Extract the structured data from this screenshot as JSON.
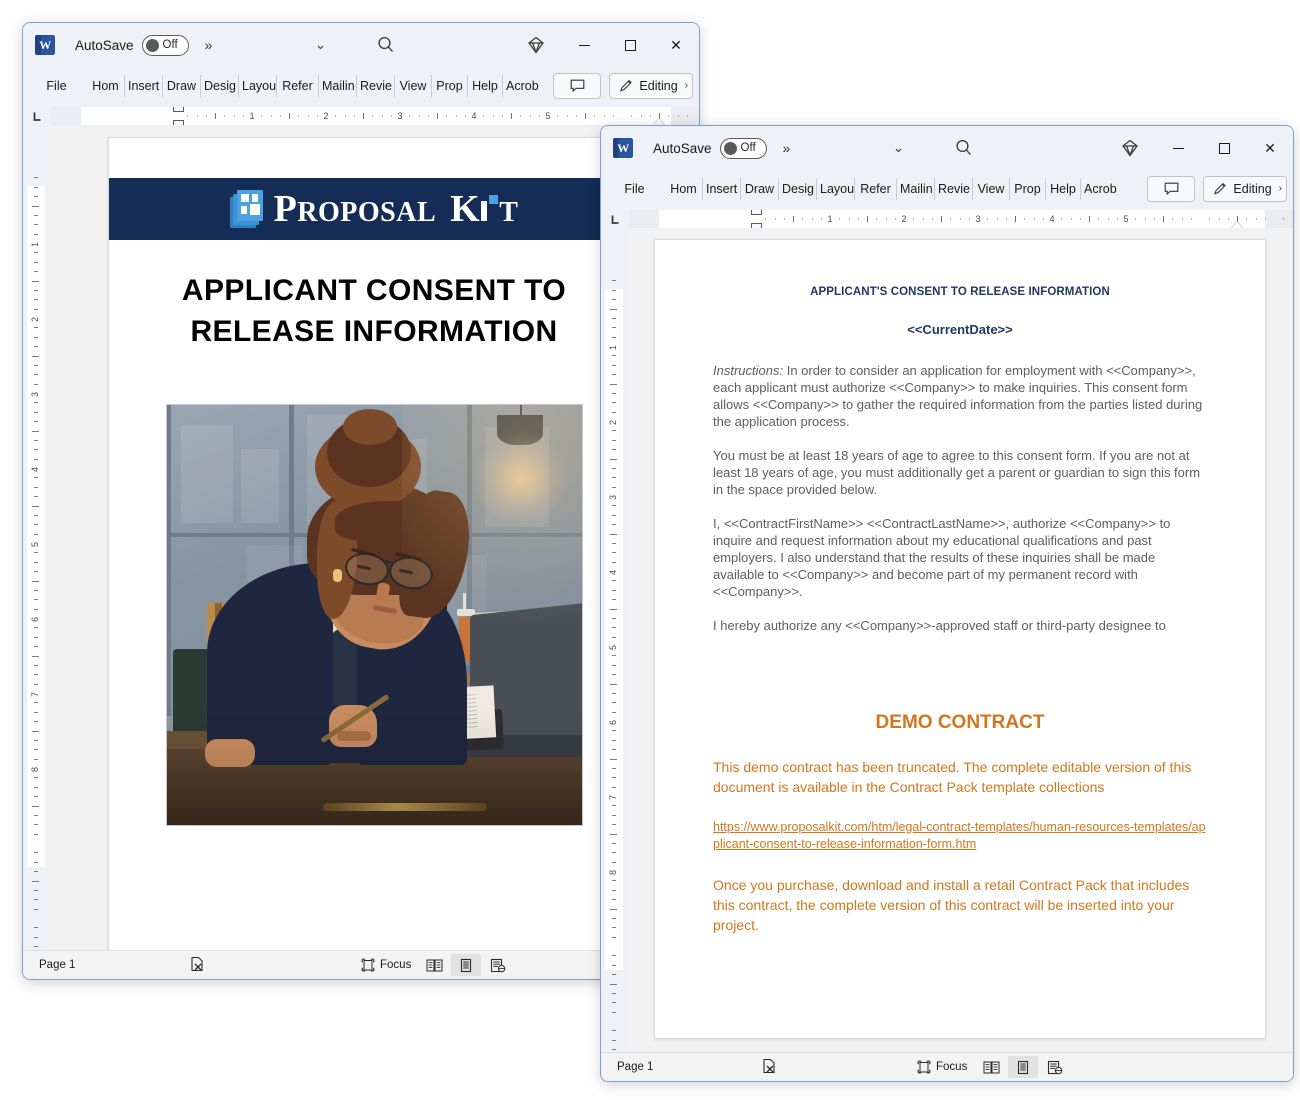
{
  "app": {
    "icon": "word-icon",
    "icon_letter": "W",
    "autosave_label": "AutoSave",
    "autosave_state": "Off",
    "overflow_chevron": "»",
    "qat_caret": "⌄",
    "search_icon": "search-icon",
    "diamond_icon": "diamond-icon",
    "minimize": "minimize-icon",
    "maximize": "maximize-icon",
    "close": "close-icon",
    "close_glyph": "✕"
  },
  "ribbon": {
    "tabs": [
      "File",
      "Hom",
      "Insert",
      "Draw",
      "Desig",
      "Layou",
      "Refer",
      "Mailin",
      "Revie",
      "View",
      "Prop",
      "Help",
      "Acrob"
    ],
    "comment_button": "comment-icon",
    "editing_label": "Editing",
    "editing_chevron": "›",
    "pencil_icon": "pencil-icon"
  },
  "ruler": {
    "tab_stop_marker": "L",
    "h_numbers": [
      "1",
      "2",
      "3",
      "4",
      "5"
    ],
    "v_numbers": [
      "1",
      "2",
      "3",
      "4",
      "5",
      "6",
      "7",
      "8"
    ]
  },
  "statusbar": {
    "page_label": "Page 1",
    "proofing_icon": "proofing-errors-icon",
    "focus_label": "Focus",
    "focus_icon": "focus-icon",
    "views": [
      {
        "name": "read-mode-view",
        "icon": "book-icon",
        "active": false
      },
      {
        "name": "print-layout-view",
        "icon": "page-icon",
        "active": true
      },
      {
        "name": "web-layout-view",
        "icon": "web-icon",
        "active": false
      }
    ]
  },
  "window_back": {
    "name": "word-window-proposal-kit-cover",
    "document": {
      "banner": {
        "brand_word_1": "P",
        "brand_word_1_rest": "ROPOSAL",
        "brand_word_2": "K",
        "brand_word_2_rest": "T",
        "background_color": "#152c56",
        "logo_icon": "proposal-kit-logo-icon"
      },
      "title_line_1": "APPLICANT CONSENT TO",
      "title_line_2": "RELEASE INFORMATION",
      "illustration_alt": "businesswoman-signing-document-illustration"
    }
  },
  "window_front": {
    "name": "word-window-consent-form",
    "document": {
      "heading": "APPLICANT'S CONSENT TO RELEASE INFORMATION",
      "date_field": "<<CurrentDate>>",
      "paragraphs": [
        {
          "lead": "Instructions:",
          "text": " In order to consider an application for employment with <<Company>>, each applicant must authorize <<Company>> to make inquiries. This consent form allows <<Company>> to gather the required information from the parties listed during the application process."
        },
        {
          "lead": "",
          "text": "You must be at least 18 years of age to agree to this consent form. If you are not at least 18 years of age, you must additionally get a parent or guardian to sign this form in the space provided below."
        },
        {
          "lead": "",
          "text": "I, <<ContractFirstName>> <<ContractLastName>>, authorize <<Company>> to inquire and request information about my educational qualifications and past employers.  I also understand that the results of these inquiries shall be made available to <<Company>> and become part of my permanent record with <<Company>>."
        },
        {
          "lead": "",
          "text": "I hereby authorize any <<Company>>-approved staff or third-party designee to"
        }
      ],
      "demo_heading": "DEMO CONTRACT",
      "demo_paragraph_1": "This demo contract has been truncated. The complete editable version of this document is available in the Contract Pack template collections",
      "demo_link": "https://www.proposalkit.com/htm/legal-contract-templates/human-resources-templates/applicant-consent-to-release-information-form.htm",
      "demo_paragraph_2": "Once you purchase, download and install a retail Contract Pack that includes this contract, the complete version of this contract will be inserted into your project.",
      "accent_color": "#d2761d",
      "heading_color": "#1f3864"
    }
  }
}
